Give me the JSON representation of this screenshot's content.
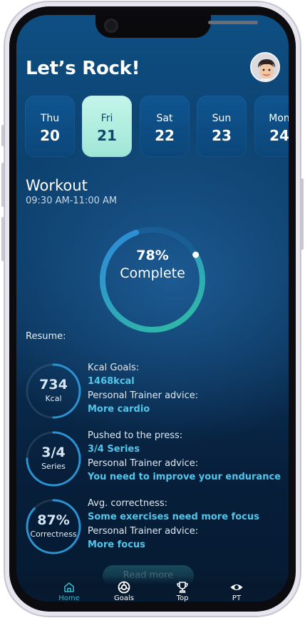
{
  "header": {
    "greeting": "Let’s Rock!"
  },
  "days": [
    {
      "name": "Thu",
      "num": "20",
      "active": false
    },
    {
      "name": "Fri",
      "num": "21",
      "active": true
    },
    {
      "name": "Sat",
      "num": "22",
      "active": false
    },
    {
      "name": "Sun",
      "num": "23",
      "active": false
    },
    {
      "name": "Mon",
      "num": "24",
      "active": false
    }
  ],
  "workout": {
    "title": "Workout",
    "time": "09:30 AM-11:00 AM",
    "progress_percent": 78,
    "progress_text": "78%",
    "progress_label": "Complete"
  },
  "resume": {
    "label": "Resume:",
    "items": [
      {
        "value": "734",
        "unit": "Kcal",
        "level": 0.5,
        "line1_label": "Kcal Goals:",
        "line1_value": "1468kcal",
        "line2_label": "Personal Trainer advice:",
        "line2_value": "More cardio"
      },
      {
        "value": "3/4",
        "unit": "Series",
        "level": 0.75,
        "line1_label": "Pushed to the press:",
        "line1_value": "3/4 Series",
        "line2_label": "Personal Trainer advice:",
        "line2_value": "You need to improve your endurance"
      },
      {
        "value": "87%",
        "unit": "Correctness",
        "level": 0.87,
        "line1_label": "Avg. correctness:",
        "line1_value": "Some exercises need more focus",
        "line2_label": "Personal Trainer advice:",
        "line2_value": "More focus"
      }
    ]
  },
  "read_more": "Read more",
  "tabs": [
    {
      "label": "Home",
      "icon": "home-icon",
      "active": true
    },
    {
      "label": "Goals",
      "icon": "goals-icon",
      "active": false
    },
    {
      "label": "Top",
      "icon": "trophy-icon",
      "active": false
    },
    {
      "label": "PT",
      "icon": "eye-icon",
      "active": false
    }
  ],
  "colors": {
    "accent": "#52c6ea",
    "active_day": "#b3efe1",
    "tab_active": "#38b6c9"
  }
}
